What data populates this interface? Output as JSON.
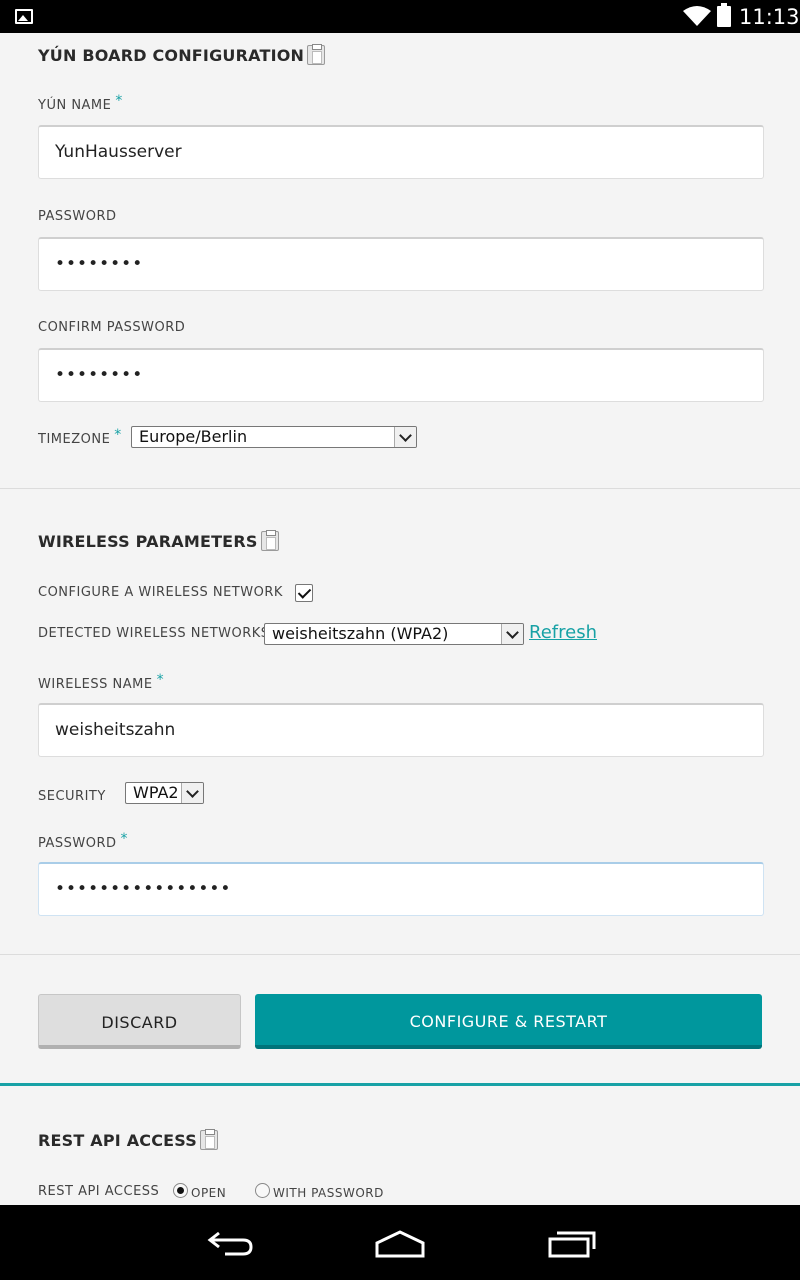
{
  "status_bar": {
    "time": "11:13",
    "icons": [
      "image-notification-icon",
      "wifi-icon",
      "battery-icon"
    ]
  },
  "board_config": {
    "title": "YÚN BOARD CONFIGURATION",
    "yun_name_label": "YÚN NAME",
    "yun_name_value": "YunHausserver",
    "password_label": "PASSWORD",
    "password_value": "••••••••",
    "confirm_password_label": "CONFIRM PASSWORD",
    "confirm_password_value": "••••••••",
    "timezone_label": "TIMEZONE",
    "timezone_value": "Europe/Berlin",
    "required_mark": "*"
  },
  "wireless": {
    "title": "WIRELESS PARAMETERS",
    "configure_label": "CONFIGURE A WIRELESS NETWORK",
    "configure_checked": true,
    "detected_label": "DETECTED WIRELESS NETWORKS",
    "detected_value": "weisheitszahn (WPA2)",
    "refresh_label": "Refresh",
    "wireless_name_label": "WIRELESS NAME",
    "wireless_name_value": "weisheitszahn",
    "security_label": "SECURITY",
    "security_value": "WPA2",
    "password_label": "PASSWORD",
    "password_value": "••••••••••••••••"
  },
  "actions": {
    "discard_label": "DISCARD",
    "configure_label": "CONFIGURE & RESTART"
  },
  "rest_api": {
    "title": "REST API ACCESS",
    "label": "REST API ACCESS",
    "option_open": "OPEN",
    "option_password": "WITH PASSWORD",
    "selected": "OPEN"
  },
  "colors": {
    "accent": "#00979d",
    "link": "#17a1a5"
  },
  "nav_bar": {
    "icons": [
      "back-icon",
      "home-icon",
      "recents-icon"
    ]
  }
}
